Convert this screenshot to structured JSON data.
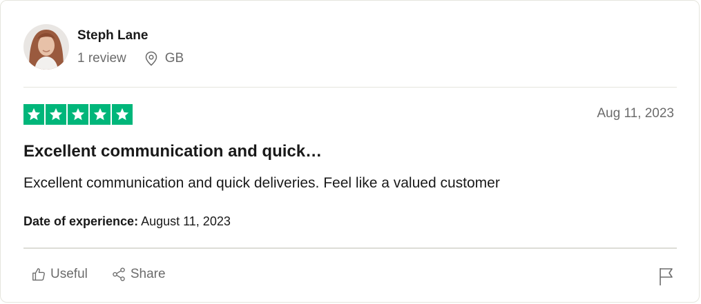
{
  "consumer": {
    "name": "Steph Lane",
    "review_count": "1 review",
    "location": "GB"
  },
  "review": {
    "rating": 5,
    "rating_color": "#00b67a",
    "date": "Aug 11, 2023",
    "title": "Excellent communication and quick…",
    "body": "Excellent communication and quick deliveries. Feel like a valued customer",
    "experience_label": "Date of experience:",
    "experience_date": "August 11, 2023"
  },
  "actions": {
    "useful_label": "Useful",
    "useful_icon": "thumbs-up-icon",
    "share_label": "Share",
    "share_icon": "share-icon",
    "report_icon": "flag-icon"
  }
}
